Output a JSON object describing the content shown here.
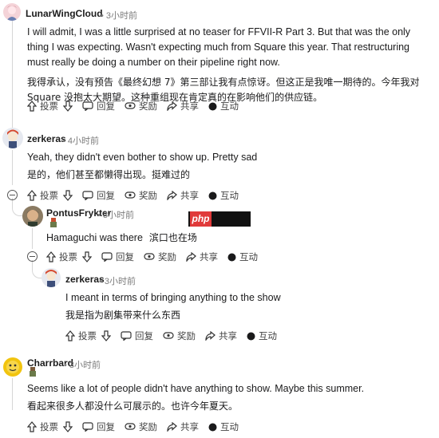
{
  "comments": [
    {
      "username": "LunarWingCloud",
      "time": "3小时前",
      "text_en": "I will admit, I was a little surprised at no teaser for FFVII-R Part 3. But that was the only thing I was expecting. Wasn't expecting much from Square this year. That restructuring must really be doing a number on their pipeline right now.",
      "text_zh": "我得承认，没有预告《最终幻想 7》第三部让我有点惊讶。但这正是我唯一期待的。今年我对 Square 没抱太大期望。这种重组现在肯定真的在影响他们的供应链。"
    },
    {
      "username": "zerkeras",
      "time": "4小时前",
      "text_en": "Yeah, they didn't even bother to show up. Pretty sad",
      "text_zh": "是的，他们甚至都懒得出现。挺难过的"
    },
    {
      "username": "PontusFrykter",
      "time": "3小时前",
      "text_en": "Hamaguchi was there",
      "text_zh": "滨口也在场"
    },
    {
      "username": "zerkeras",
      "time": "3小时前",
      "text_en": "I meant in terms of bringing anything to the show",
      "text_zh": "我是指为剧集带来什么东西"
    },
    {
      "username": "Charrbard",
      "time": "3小时前",
      "text_en": "Seems like a lot of people didn't have anything to show. Maybe this summer.",
      "text_zh": "看起来很多人都没什么可展示的。也许今年夏天。"
    }
  ],
  "actions": {
    "upvote": "投票",
    "reply": "回复",
    "award": "奖励",
    "share": "共享",
    "interact": "互动"
  },
  "meta_separator": "•",
  "watermark": "php",
  "colors": {
    "watermark_red": "#e03a3a",
    "thread_line": "#d6d6d6"
  }
}
